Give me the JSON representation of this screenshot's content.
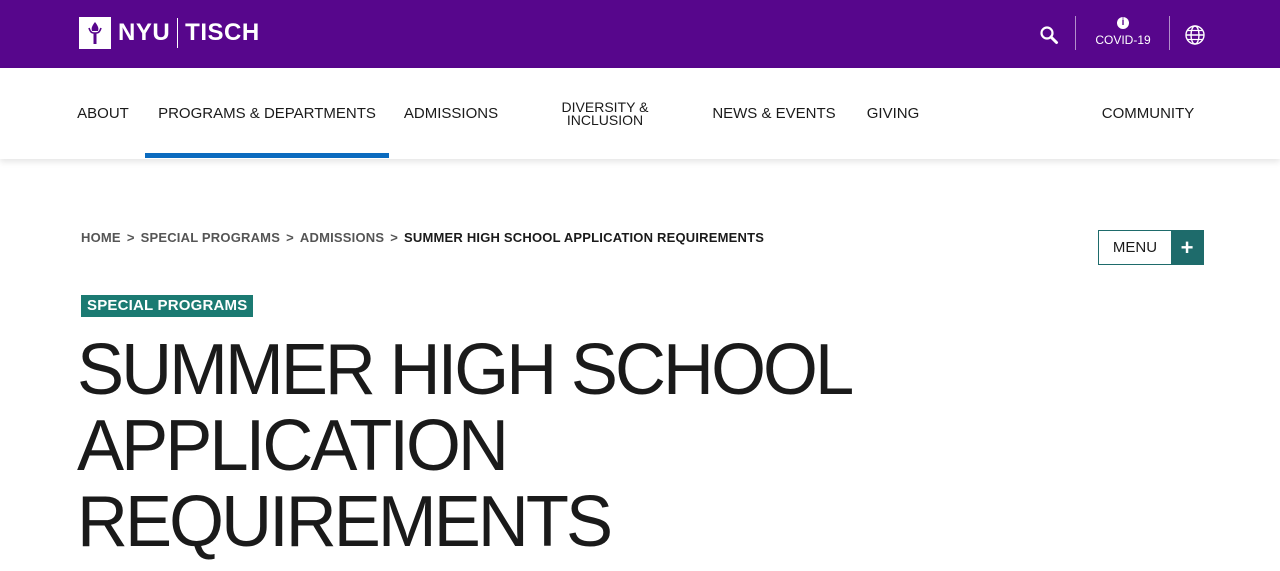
{
  "colors": {
    "brand_purple": "#57068c",
    "accent_blue": "#0b6bbf",
    "accent_teal": "#1b7a72"
  },
  "header": {
    "logo_nyu": "NYU",
    "logo_tisch": "TISCH",
    "logo_icon": "torch-icon",
    "search_icon": "search-icon",
    "covid_icon": "info-icon",
    "covid_label": "COVID-19",
    "globe_icon": "globe-icon"
  },
  "nav": {
    "items": [
      {
        "label": "ABOUT"
      },
      {
        "label": "PROGRAMS & DEPARTMENTS",
        "active": true
      },
      {
        "label": "ADMISSIONS"
      },
      {
        "label_line1": "DIVERSITY &",
        "label_line2": "INCLUSION"
      },
      {
        "label": "NEWS & EVENTS"
      },
      {
        "label": "GIVING"
      },
      {
        "label": "COMMUNITY"
      }
    ]
  },
  "breadcrumb": {
    "items": [
      "HOME",
      "SPECIAL PROGRAMS",
      "ADMISSIONS"
    ],
    "separator": ">",
    "current": "SUMMER HIGH SCHOOL APPLICATION REQUIREMENTS"
  },
  "menu_button": {
    "label": "MENU",
    "icon": "+"
  },
  "page": {
    "tag": "SPECIAL PROGRAMS",
    "title_lines": [
      "SUMMER HIGH SCHOOL",
      "APPLICATION",
      "REQUIREMENTS"
    ]
  }
}
